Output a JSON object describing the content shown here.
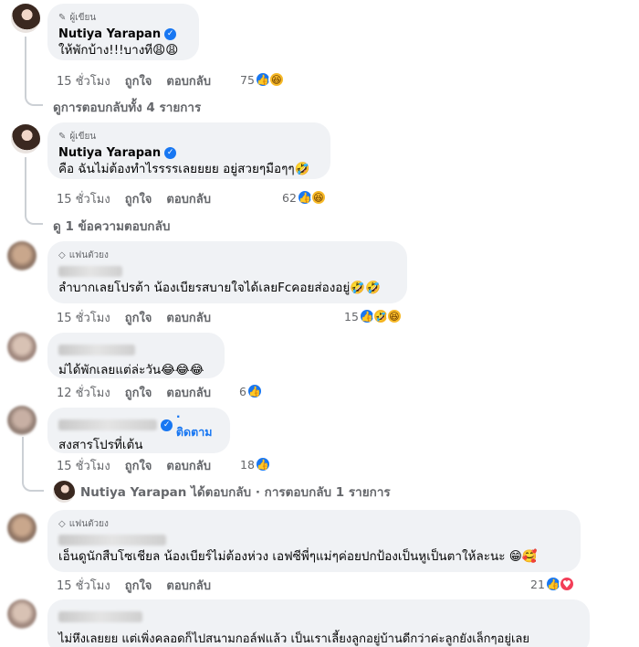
{
  "comments": [
    {
      "badge": "ผู้เขียน",
      "name": "Nutiya Yarapan",
      "text": "ให้พักบ้าง!!!บางที😩😩",
      "time": "15 ชั่วโมง",
      "like": "ถูกใจ",
      "reply": "ตอบกลับ",
      "count": "75",
      "view_replies": "ดูการตอบกลับทั้ง 4 รายการ"
    },
    {
      "badge": "ผู้เขียน",
      "name": "Nutiya Yarapan",
      "text": "คือ ฉันไม่ต้องทำไรรรรเลยยยย อยู่สวยๆมือๆๆ🤣",
      "time": "15 ชั่วโมง",
      "like": "ถูกใจ",
      "reply": "ตอบกลับ",
      "count": "62",
      "view_replies": "ดู 1 ข้อความตอบกลับ"
    },
    {
      "badge": "แฟนตัวยง",
      "text": "ลำบากเลยโปรต้า น้องเบียรสบายใจได้เลยFcคอยส่องอยู่🤣🤣",
      "time": "15 ชั่วโมง",
      "like": "ถูกใจ",
      "reply": "ตอบกลับ",
      "count": "15"
    },
    {
      "text": "ม่ได้พักเลยแต่ล่ะวัน😂😂😂",
      "time": "12 ชั่วโมง",
      "like": "ถูกใจ",
      "reply": "ตอบกลับ",
      "count": "6"
    },
    {
      "follow": "· ติดตาม",
      "text": "สงสารโปรที่เต้น",
      "time": "15 ชั่วโมง",
      "like": "ถูกใจ",
      "reply": "ตอบกลับ",
      "count": "18",
      "reply_summary": "Nutiya Yarapan ได้ตอบกลับ · การตอบกลับ 1 รายการ"
    },
    {
      "badge": "แฟนตัวยง",
      "text": "เอ็นดูนักสืบโซเชียล น้องเบียร์ไม่ต้องห่วง เอฟซีพี่ๆแม่ๆค่อยปกป้องเป็นหูเป็นตาให้ละนะ 😁🥰",
      "time": "15 ชั่วโมง",
      "like": "ถูกใจ",
      "reply": "ตอบกลับ",
      "count": "21"
    },
    {
      "text": "ไม่หึงเลยยย แต่เพิ่งคลอดก็ไปสนามกอล์ฟแล้ว เป็นเราเลี้ยงลูกอยู่บ้านดีกว่าค่ะลูกยังเล็กๆอยู่เลย"
    }
  ],
  "icons": {
    "author": "pencil-icon",
    "fan": "diamond-icon",
    "verified": "verified-badge-icon",
    "like": "like-reaction-icon",
    "haha": "haha-reaction-icon",
    "love": "love-reaction-icon"
  },
  "colors": {
    "link_blue": "#1877f2",
    "bubble": "#f0f2f5",
    "secondary_text": "#65676b"
  }
}
